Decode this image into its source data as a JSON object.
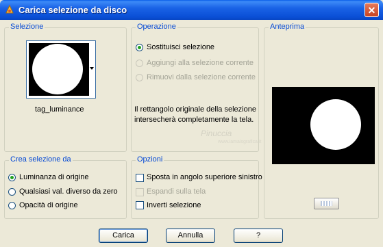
{
  "window": {
    "title": "Carica selezione da disco",
    "close_glyph": "✕"
  },
  "selezione": {
    "legend": "Selezione",
    "thumbnail_name": "tag_luminance"
  },
  "operazione": {
    "legend": "Operazione",
    "options": [
      {
        "label": "Sostituisci selezione",
        "checked": true,
        "enabled": true
      },
      {
        "label": "Aggiungi alla selezione corrente",
        "checked": false,
        "enabled": false
      },
      {
        "label": "Rimuovi dalla selezione corrente",
        "checked": false,
        "enabled": false
      }
    ],
    "description_line1": "Il rettangolo originale della selezione",
    "description_line2": "intersecherà completamente la tela."
  },
  "anteprima": {
    "legend": "Anteprima"
  },
  "crea": {
    "legend": "Crea selezione da",
    "options": [
      {
        "label": "Luminanza di origine",
        "checked": true
      },
      {
        "label": "Qualsiasi val. diverso da zero",
        "checked": false
      },
      {
        "label": "Opacità di origine",
        "checked": false
      }
    ]
  },
  "opzioni": {
    "legend": "Opzioni",
    "options": [
      {
        "label": "Sposta in angolo superiore sinistro",
        "checked": false,
        "enabled": true
      },
      {
        "label": "Espandi sulla tela",
        "checked": false,
        "enabled": false
      },
      {
        "label": "Inverti selezione",
        "checked": false,
        "enabled": true
      }
    ]
  },
  "watermark": {
    "text": "Pinuccia",
    "sub": "www.iamaisgrafica.it"
  },
  "buttons": {
    "load": "Carica",
    "cancel": "Annulla",
    "help": "?"
  },
  "colors": {
    "legend": "#0046d5",
    "titlebar": "#0a4fd6",
    "radio_dot": "#21a121"
  }
}
